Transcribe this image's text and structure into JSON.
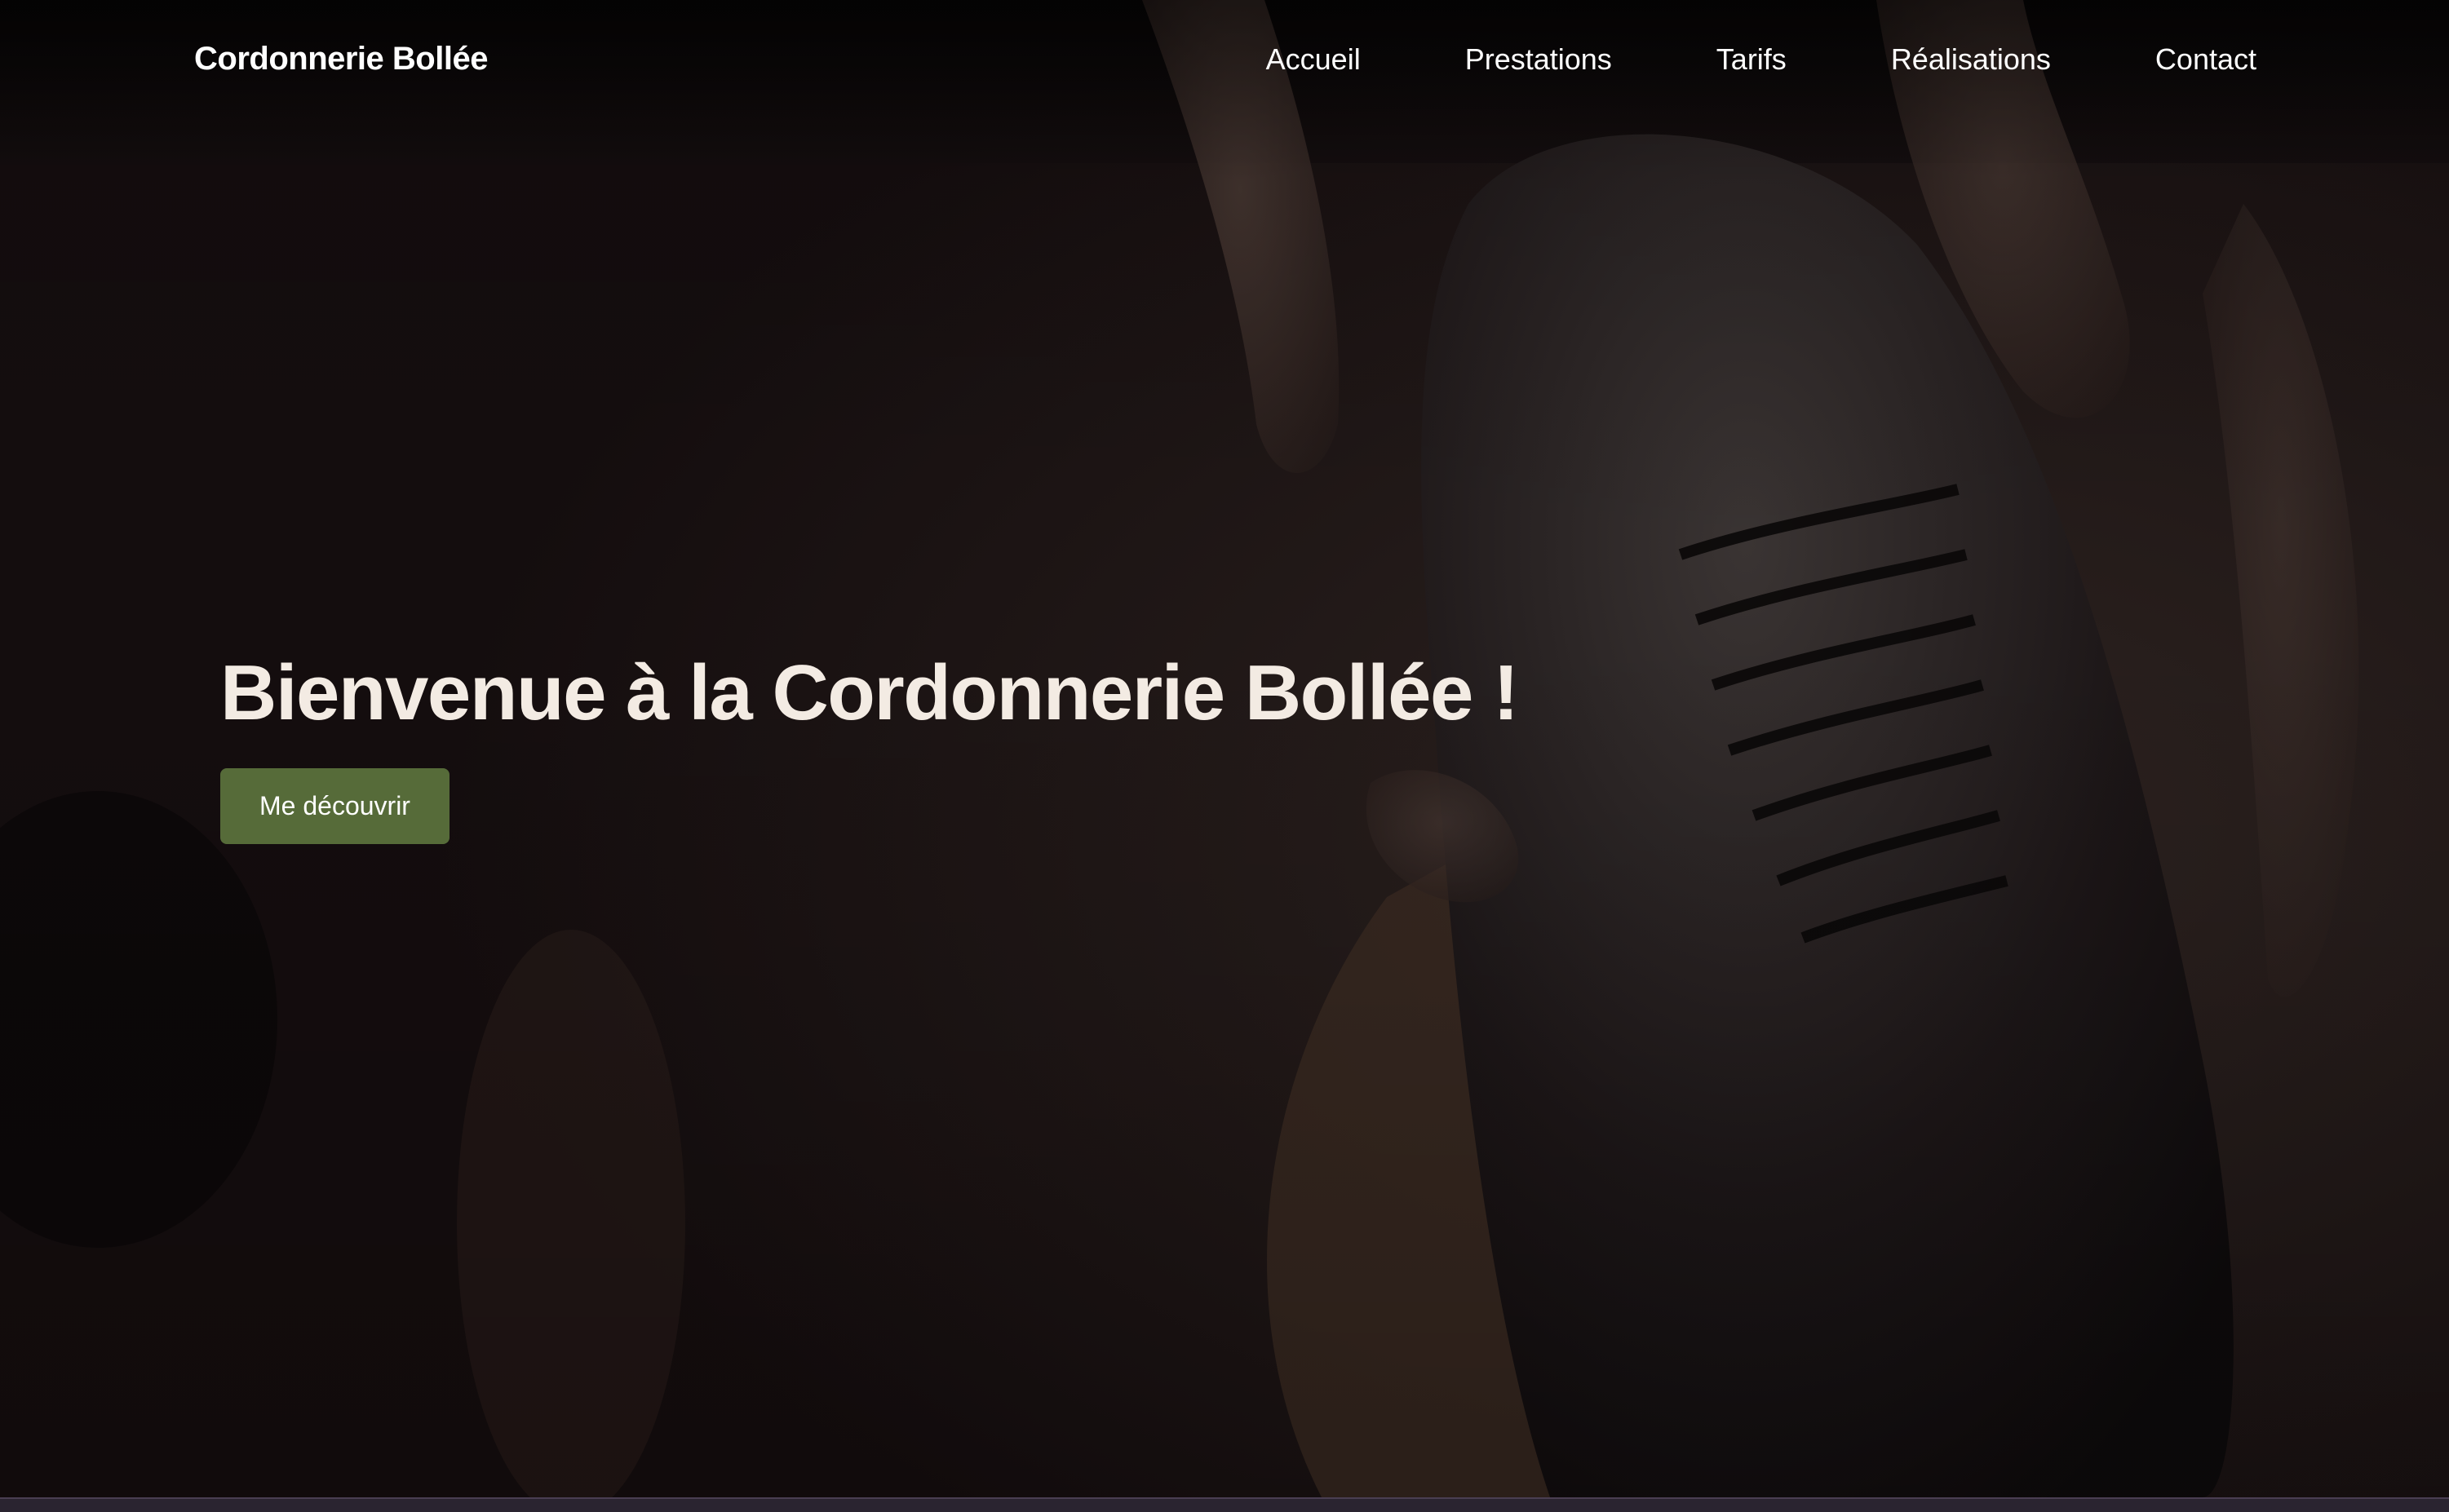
{
  "header": {
    "brand": "Cordonnerie Bollée",
    "nav": [
      {
        "label": "Accueil"
      },
      {
        "label": "Prestations"
      },
      {
        "label": "Tarifs"
      },
      {
        "label": "Réalisations"
      },
      {
        "label": "Contact"
      }
    ]
  },
  "hero": {
    "title": "Bienvenue à la Cordonnerie Bollée !",
    "button_label": "Me découvrir",
    "background_image": "shoe-being-laced-photo"
  },
  "colors": {
    "accent": "#566b39",
    "title_text": "#f3ebe3",
    "nav_text": "#ffffff",
    "background": "#160f0f"
  }
}
